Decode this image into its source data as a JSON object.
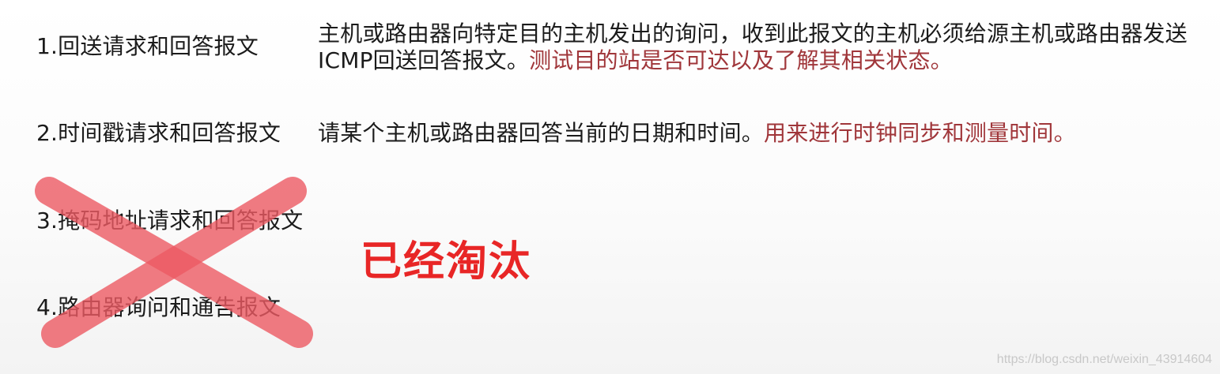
{
  "items": [
    {
      "title": "1.回送请求和回答报文",
      "desc_main": "主机或路由器向特定目的主机发出的询问，收到此报文的主机必须给源主机或路由器发送ICMP回送回答报文。",
      "desc_highlight": "测试目的站是否可达以及了解其相关状态。"
    },
    {
      "title": "2.时间戳请求和回答报文",
      "desc_main": "请某个主机或路由器回答当前的日期和时间。",
      "desc_highlight": "用来进行时钟同步和测量时间。"
    },
    {
      "title": "3.掩码地址请求和回答报文"
    },
    {
      "title": "4.路由器询问和通告报文"
    }
  ],
  "deprecated_label": "已经淘汰",
  "watermark": "https://blog.csdn.net/weixin_43914604",
  "colors": {
    "text": "#1b1b1b",
    "highlight": "#a0363a",
    "label": "#e82626",
    "cross": "#ec5a63"
  }
}
